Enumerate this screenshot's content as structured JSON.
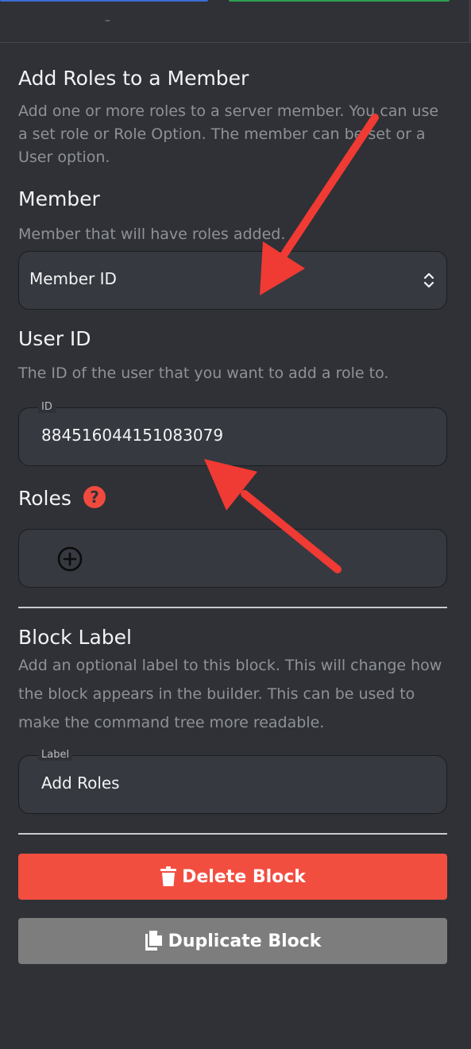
{
  "topbar": {
    "dash": "–"
  },
  "panel": {
    "title": "Add Roles to a Member",
    "description": "Add one or more roles to a server member. You can use a set role or Role Option. The member can be set or a User option."
  },
  "member": {
    "heading": "Member",
    "description": "Member that will have roles added.",
    "select_value": "Member ID"
  },
  "user_id": {
    "heading": "User ID",
    "description": "The ID of the user that you want to add a role to.",
    "field_label": "ID",
    "field_value": "884516044151083079"
  },
  "roles": {
    "heading": "Roles",
    "help_glyph": "?"
  },
  "block_label": {
    "heading": "Block Label",
    "description": "Add an optional label to this block. This will change how the block appears in the builder. This can be used to make the command tree more readable.",
    "field_label": "Label",
    "field_value": "Add Roles"
  },
  "buttons": {
    "delete": "Delete Block",
    "duplicate": "Duplicate Block"
  },
  "colors": {
    "background": "#2f3136",
    "field_bg": "#36393f",
    "danger": "#f24e40",
    "neutral_button": "#7d7d7d",
    "annotation_arrow": "#f03a34"
  }
}
